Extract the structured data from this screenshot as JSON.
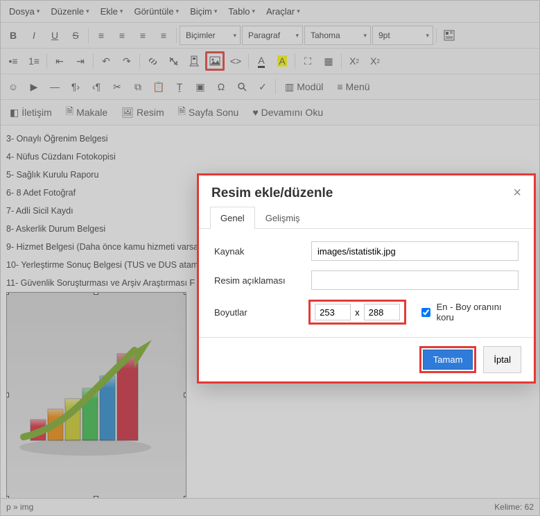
{
  "menubar": {
    "items": [
      {
        "label": "Dosya"
      },
      {
        "label": "Düzenle"
      },
      {
        "label": "Ekle"
      },
      {
        "label": "Görüntüle"
      },
      {
        "label": "Biçim"
      },
      {
        "label": "Tablo"
      },
      {
        "label": "Araçlar"
      }
    ]
  },
  "toolbar": {
    "styles_label": "Biçimler",
    "block_label": "Paragraf",
    "font_label": "Tahoma",
    "size_label": "9pt",
    "iletisim": "İletişim",
    "makale": "Makale",
    "resim": "Resim",
    "sayfa_sonu": "Sayfa Sonu",
    "devamini_oku": "Devamını Oku",
    "modul": "Modül",
    "menu": "Menü"
  },
  "content_lines": [
    "3- Onaylı Öğrenim Belgesi",
    "4- Nüfus Cüzdanı Fotokopisi",
    "5- Sağlık Kurulu Raporu",
    "6- 8 Adet Fotoğraf",
    "7- Adli Sicil Kaydı",
    "8- Askerlik Durum Belgesi",
    "9- Hizmet Belgesi (Daha önce kamu hizmeti varsa",
    "10- Yerleştirme Sonuç Belgesi (TUS ve DUS atam",
    "11- Güvenlik Soruşturması ve Arşiv Araştırması F"
  ],
  "dialog": {
    "title": "Resim ekle/düzenle",
    "tab_general": "Genel",
    "tab_advanced": "Gelişmiş",
    "label_source": "Kaynak",
    "value_source": "images/istatistik.jpg",
    "label_alt": "Resim açıklaması",
    "value_alt": "",
    "label_dimensions": "Boyutlar",
    "width": "253",
    "height": "288",
    "dim_sep": "x",
    "constrain": "En - Boy oranını koru",
    "ok": "Tamam",
    "cancel": "İptal"
  },
  "statusbar": {
    "path": "p » img",
    "wordcount": "Kelime: 62"
  }
}
